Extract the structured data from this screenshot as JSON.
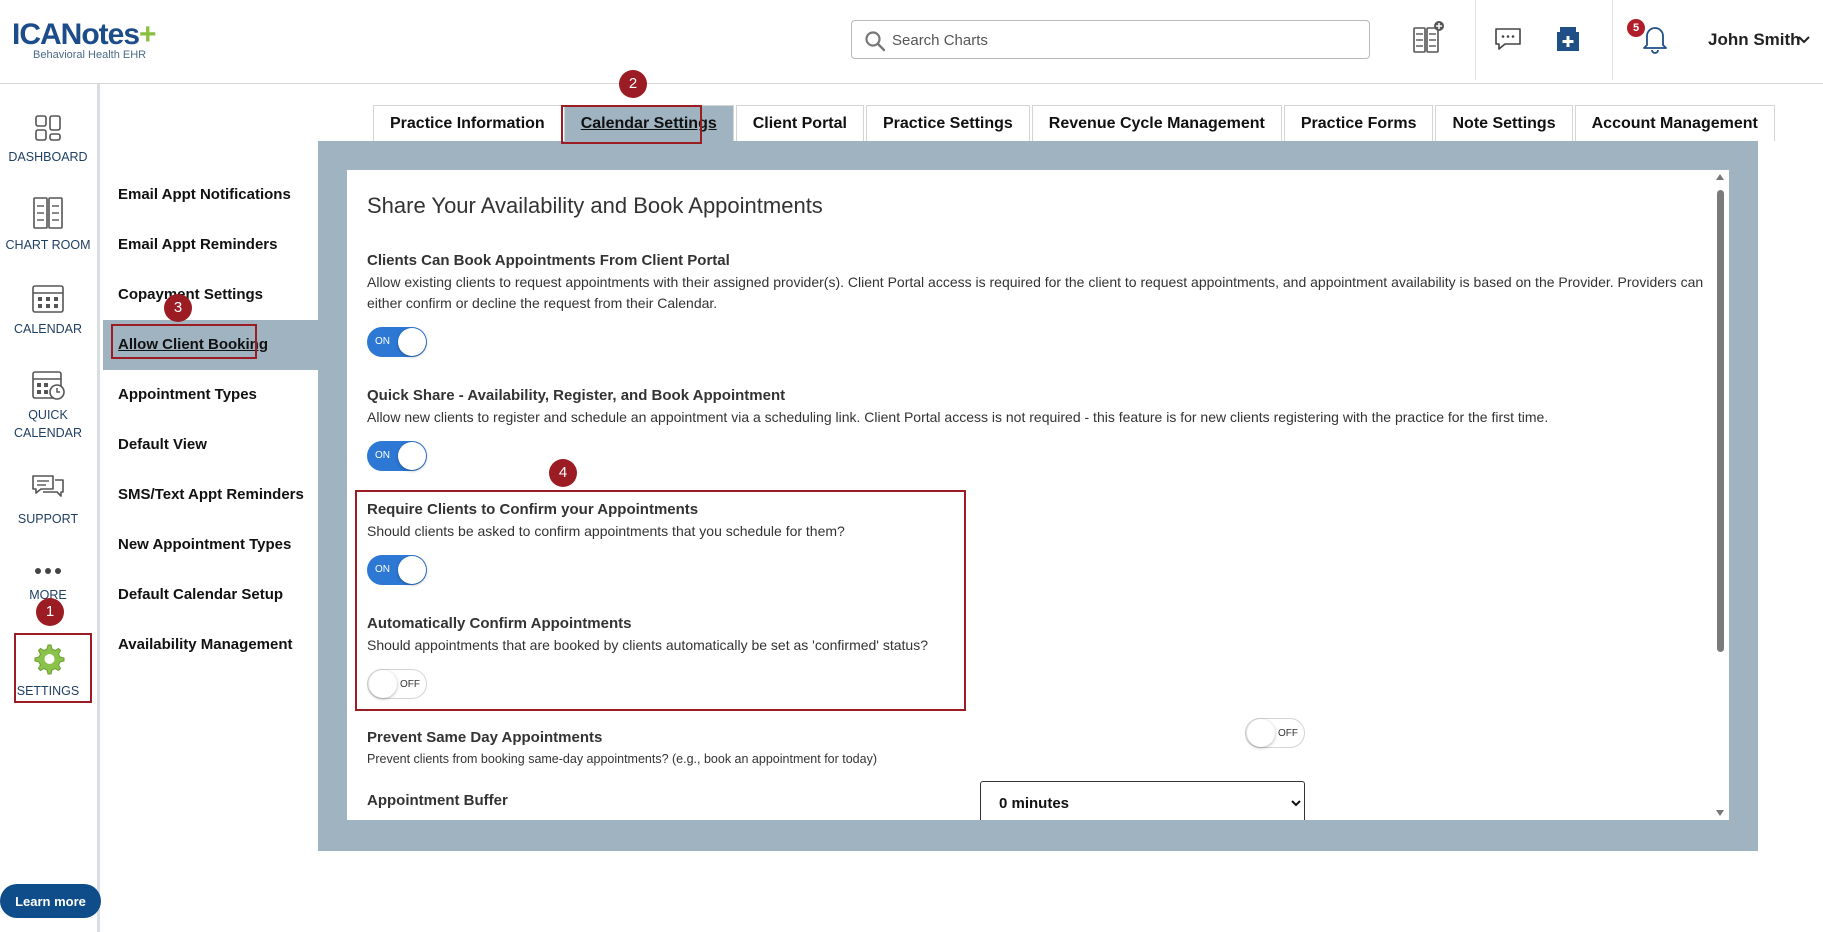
{
  "header": {
    "logo_text": "ICANotes",
    "logo_plus": "+",
    "logo_subtitle": "Behavioral Health EHR",
    "search_placeholder": "Search Charts",
    "notification_count": "5",
    "user_name": "John Smith"
  },
  "rail": {
    "items": [
      {
        "label": "DASHBOARD",
        "icon": "dashboard-icon"
      },
      {
        "label": "CHART ROOM",
        "icon": "chart-room-icon"
      },
      {
        "label": "CALENDAR",
        "icon": "calendar-icon"
      },
      {
        "label": "QUICK CALENDAR",
        "icon": "quick-calendar-icon"
      },
      {
        "label": "SUPPORT",
        "icon": "support-icon"
      },
      {
        "label": "MORE",
        "icon": "more-icon"
      },
      {
        "label": "SETTINGS",
        "icon": "gear-icon"
      }
    ],
    "learn_more": "Learn more"
  },
  "tabs": [
    "Practice Information",
    "Calendar Settings",
    "Client Portal",
    "Practice Settings",
    "Revenue Cycle Management",
    "Practice Forms",
    "Note Settings",
    "Account Management"
  ],
  "active_tab": "Calendar Settings",
  "subnav": [
    "Email Appt Notifications",
    "Email Appt Reminders",
    "Copayment Settings",
    "Allow Client Booking",
    "Appointment Types",
    "Default View",
    "SMS/Text Appt Reminders",
    "New Appointment Types",
    "Default Calendar Setup",
    "Availability Management"
  ],
  "active_subnav": "Allow Client Booking",
  "panel": {
    "title": "Share Your Availability and Book Appointments",
    "settings": [
      {
        "title": "Clients Can Book Appointments From Client Portal",
        "desc": "Allow existing clients to request appointments with their assigned provider(s). Client Portal access is required for the client to request appointments, and appointment availability is based on the Provider. Providers can either confirm or decline the request from their Calendar.",
        "toggle": "ON"
      },
      {
        "title": "Quick Share - Availability, Register, and Book Appointment",
        "desc": "Allow new clients to register and schedule an appointment via a scheduling link. Client Portal access is not required - this feature is for new clients registering with the practice for the first time.",
        "toggle": "ON"
      },
      {
        "title": "Require Clients to Confirm your Appointments",
        "desc": "Should clients be asked to confirm appointments that you schedule for them?",
        "toggle": "ON"
      },
      {
        "title": "Automatically Confirm Appointments",
        "desc": "Should appointments that are booked by clients automatically be set as 'confirmed' status?",
        "toggle": "OFF"
      },
      {
        "title": "Prevent Same Day Appointments",
        "desc": "Prevent clients from booking same-day appointments? (e.g., book an appointment for today)",
        "toggle": "OFF"
      },
      {
        "title": "Appointment Buffer",
        "desc": "",
        "select_value": "0 minutes"
      }
    ]
  },
  "annotations": {
    "step1": "1",
    "step2": "2",
    "step3": "3",
    "step4": "4",
    "color": "#9b1c23"
  },
  "colors": {
    "brand_blue": "#1c4c8a",
    "brand_green": "#8bbf3f",
    "toggle_on": "#2d78d4",
    "frame_bg": "#9fb3c1"
  }
}
